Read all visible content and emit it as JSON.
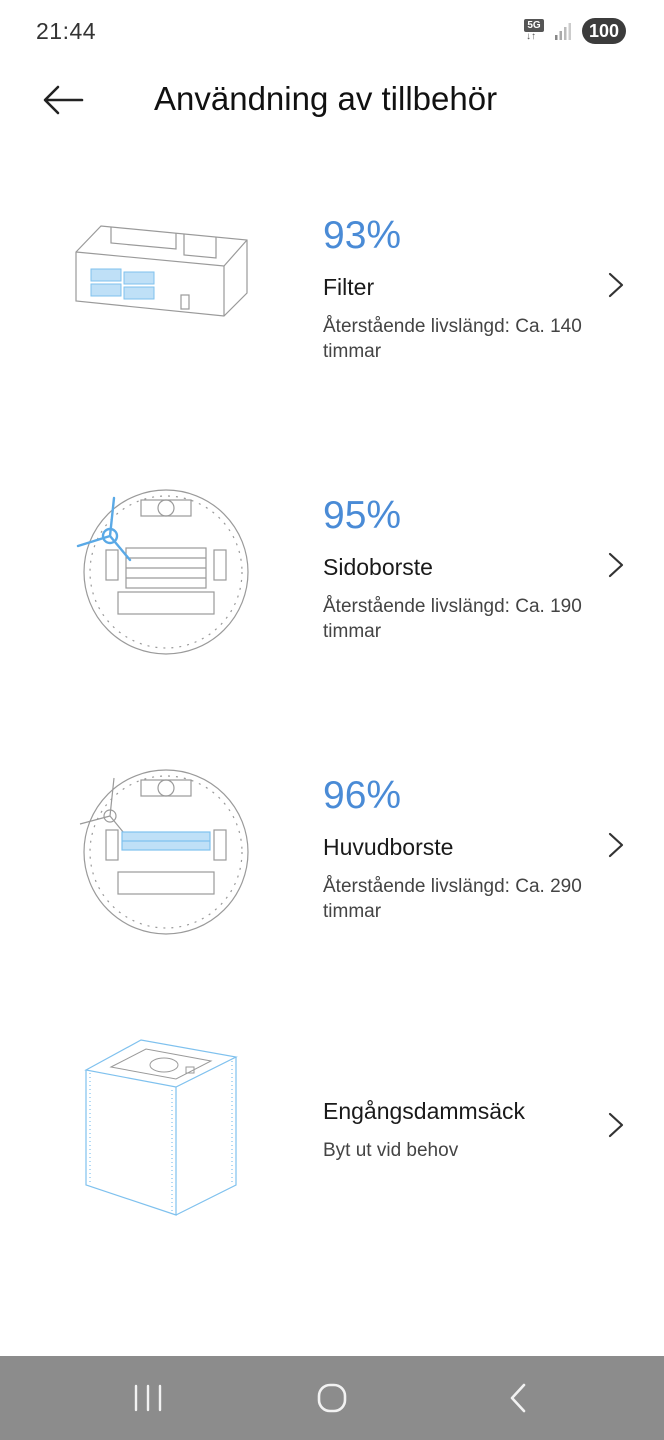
{
  "status": {
    "time": "21:44",
    "network": "5G",
    "battery": "100"
  },
  "header": {
    "title": "Användning av tillbehör"
  },
  "items": [
    {
      "percent": "93%",
      "name": "Filter",
      "desc": "Återstående livslängd: Ca. 140 timmar",
      "illustration": "filter-illustration"
    },
    {
      "percent": "95%",
      "name": "Sidoborste",
      "desc": "Återstående livslängd: Ca. 190 timmar",
      "illustration": "side-brush-illustration"
    },
    {
      "percent": "96%",
      "name": "Huvudborste",
      "desc": "Återstående livslängd: Ca. 290 timmar",
      "illustration": "main-brush-illustration"
    },
    {
      "percent": "",
      "name": "Engångsdammsäck",
      "desc": "Byt ut vid behov",
      "illustration": "dust-bag-illustration"
    }
  ],
  "colors": {
    "accent": "#4a8bd6",
    "nav_bar": "#8c8c8c",
    "line_art": "#9a9a9a",
    "highlight": "#7fc1ee"
  },
  "navbar": {
    "icons": [
      "recent-apps-icon",
      "home-icon",
      "back-icon"
    ]
  }
}
